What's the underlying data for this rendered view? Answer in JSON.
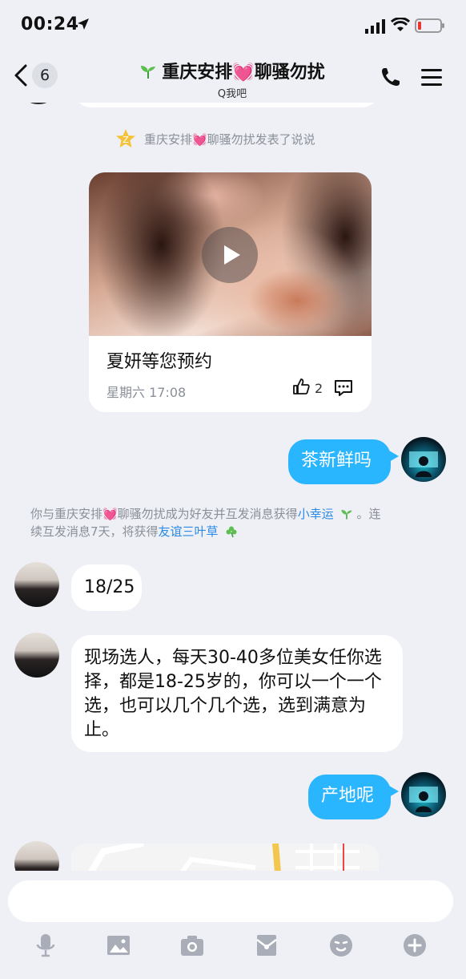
{
  "status_bar": {
    "time": "00:24"
  },
  "nav": {
    "back_count": "6",
    "title": "重庆安排💓聊骚勿扰",
    "subtitle": "Q我吧"
  },
  "chat": {
    "system_post_notice": "重庆安排💓聊骚勿扰发表了说说",
    "post_card": {
      "caption": "夏妍等您预约",
      "time": "星期六 17:08",
      "like_count": "2"
    },
    "friend_notice": {
      "part1": "你与重庆安排💓聊骚勿扰成为好友并互发消息获得",
      "link1": "小幸运",
      "part2": "。连",
      "part3": "续互发消息7天，将获得",
      "link2": "友谊三叶草"
    },
    "messages": [
      {
        "side": "right",
        "text": "茶新鲜吗"
      },
      {
        "side": "left",
        "text": "18/25"
      },
      {
        "side": "left",
        "text": "现场选人，每天30-40多位美女任你选择，都是18-25岁的，你可以一个一个选，也可以几个几个选，选到满意为止。"
      },
      {
        "side": "right",
        "text": "产地呢"
      }
    ]
  },
  "input": {
    "placeholder": ""
  },
  "colors": {
    "accent_blue": "#2ab5ff",
    "link_blue": "#2b8ae6",
    "background": "#eef0f5"
  }
}
